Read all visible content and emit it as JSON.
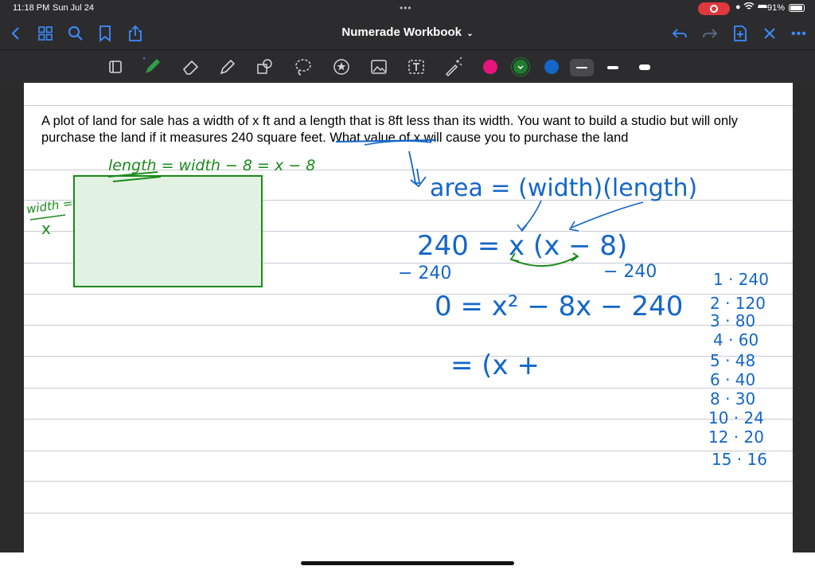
{
  "status_bar": {
    "time": "11:18 PM",
    "date": "Sun Jul 24",
    "battery": "91%"
  },
  "nav": {
    "title": "Numerade Workbook",
    "title_chevron": "⌄",
    "icons": [
      "back-chevron-icon",
      "thumbnails-grid-icon",
      "search-icon",
      "bookmark-icon",
      "share-icon",
      "undo-icon",
      "redo-icon",
      "add-page-icon",
      "close-icon",
      "more-icon"
    ]
  },
  "toolbar": {
    "tools": [
      "read-mode-icon",
      "pen-icon",
      "eraser-icon",
      "highlighter-icon",
      "shapes-icon",
      "lasso-icon",
      "sticker-icon",
      "image-icon",
      "text-box-icon",
      "laser-pointer-icon"
    ],
    "colors": [
      "#e6157d",
      "#1e7c2e",
      "#1466c8"
    ],
    "accent": "#3d8cff"
  },
  "page": {
    "problem_text": "A plot of land for sale has a width of x ft and a length that is 8ft less than its width. You want to build a studio but will only purchase the land if it measures 240 square feet. What value of x will cause you to purchase the land",
    "handwriting": {
      "length_label": "length = width − 8 = x − 8",
      "width_label": "width =",
      "width_var": "x",
      "area_eq": "area = (width)(length)",
      "eq1": "240 = x (x − 8)",
      "minus_left": "− 240",
      "minus_right": "− 240",
      "eq2": "0 = x² − 8x − 240",
      "eq3": "= (x +",
      "factors": [
        "1 · 240",
        "2 · 120",
        "3 · 80",
        "4 · 60",
        "5 · 48",
        "6 · 40",
        "8 · 30",
        "10 · 24",
        "12 · 20",
        "15 · 16"
      ]
    }
  }
}
